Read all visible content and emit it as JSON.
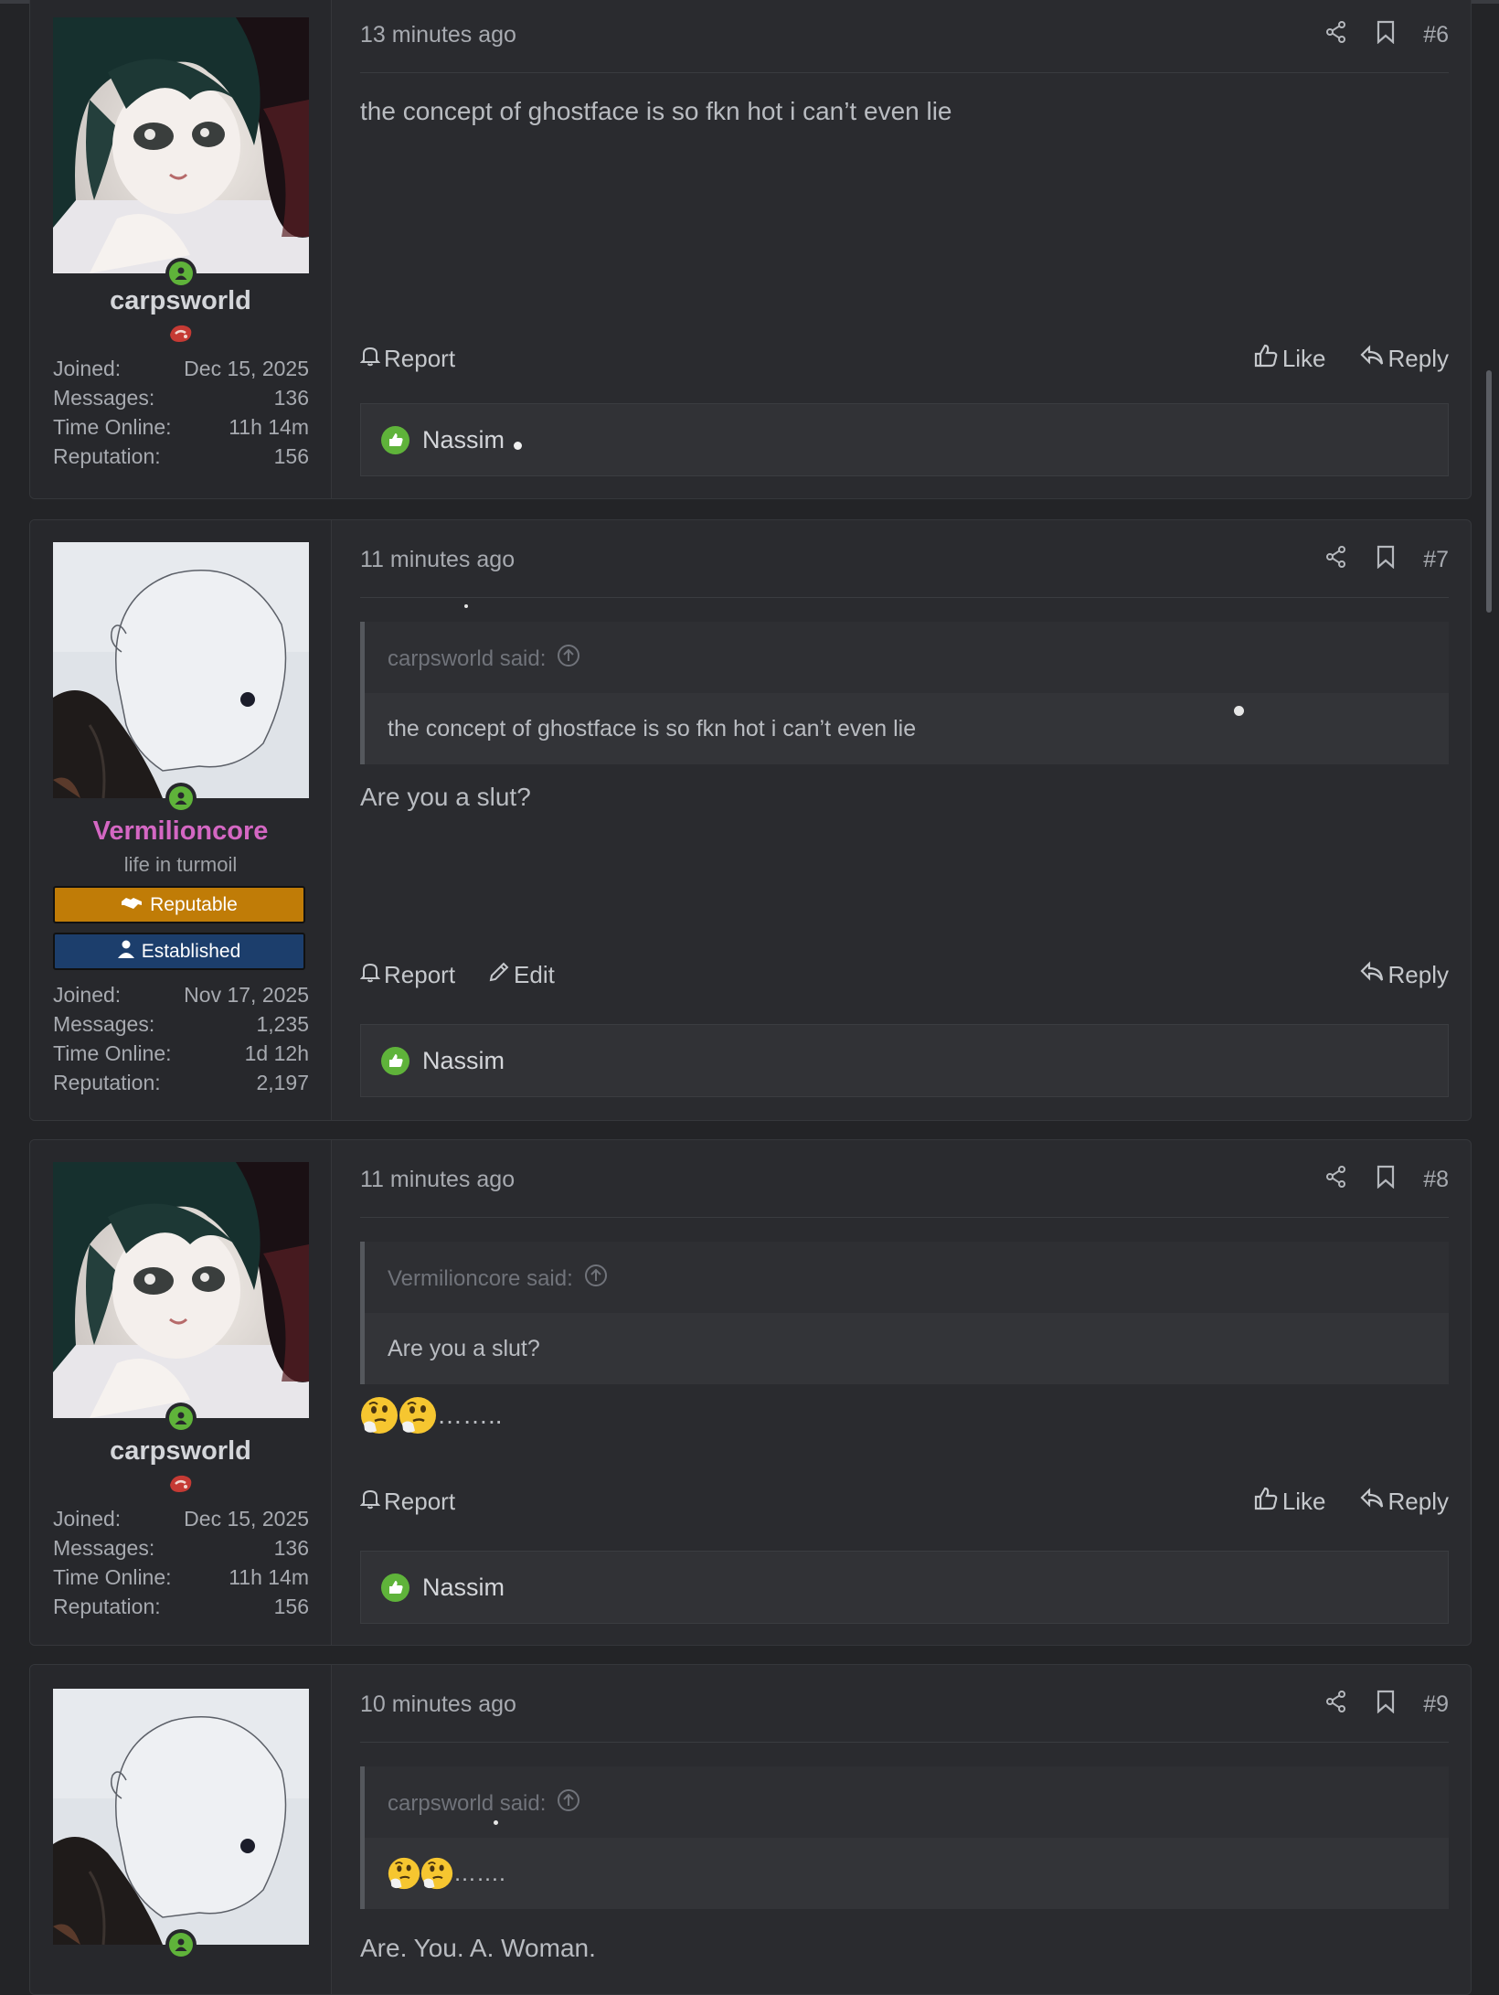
{
  "posts": [
    {
      "user": {
        "name": "carpsworld",
        "joined": "Dec 15, 2025",
        "messages": "136",
        "time_online": "11h 14m",
        "reputation": "156"
      },
      "time": "13 minutes ago",
      "number": "#6",
      "message": "the concept of ghostface is so fkn hot i can’t even lie",
      "actions": {
        "report": "Report",
        "like": "Like",
        "reply": "Reply"
      },
      "liked_by": "Nassim"
    },
    {
      "user": {
        "name": "Vermilioncore",
        "title": "life in turmoil",
        "banners": [
          "Reputable",
          "Established"
        ],
        "joined": "Nov 17, 2025",
        "messages": "1,235",
        "time_online": "1d 12h",
        "reputation": "2,197"
      },
      "time": "11 minutes ago",
      "number": "#7",
      "quote": {
        "author": "carpsworld said:",
        "text": "the concept of ghostface is so fkn hot i can’t even lie"
      },
      "message": "Are you a slut?",
      "actions": {
        "report": "Report",
        "edit": "Edit",
        "reply": "Reply"
      },
      "liked_by": "Nassim"
    },
    {
      "user": {
        "name": "carpsworld",
        "joined": "Dec 15, 2025",
        "messages": "136",
        "time_online": "11h 14m",
        "reputation": "156"
      },
      "time": "11 minutes ago",
      "number": "#8",
      "quote": {
        "author": "Vermilioncore said:",
        "text": "Are you a slut?"
      },
      "message": "……..",
      "actions": {
        "report": "Report",
        "like": "Like",
        "reply": "Reply"
      },
      "liked_by": "Nassim"
    },
    {
      "time": "10 minutes ago",
      "number": "#9",
      "quote": {
        "author": "carpsworld said:",
        "text": "……."
      },
      "message": "Are. You. A. Woman."
    }
  ],
  "stat_labels": {
    "joined": "Joined:",
    "messages": "Messages:",
    "time_online": "Time Online:",
    "reputation": "Reputation:"
  },
  "colors": {
    "online": "#5fb33a",
    "username_pink": "#d467c3",
    "banner_reputable": "#c07c07",
    "banner_established": "#1c3e6c"
  },
  "icons": [
    "share-icon",
    "bookmark-icon",
    "bell-icon",
    "thumbs-up-icon",
    "reply-arrow-icon",
    "pencil-icon",
    "arrow-up-circle-icon",
    "person-icon",
    "handshake-icon",
    "thinking-emoji"
  ]
}
